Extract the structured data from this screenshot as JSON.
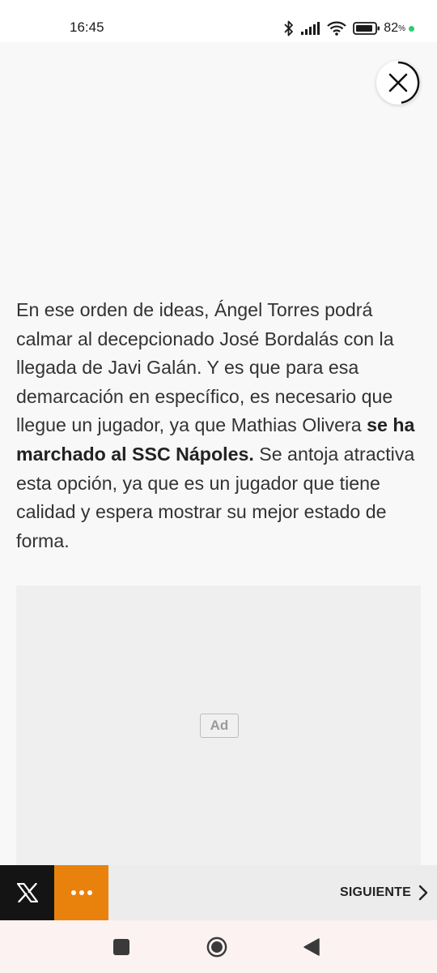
{
  "status_bar": {
    "time": "16:45",
    "battery_percent": "82",
    "battery_unit": "%",
    "icons": [
      "bluetooth-icon",
      "signal-icon",
      "wifi-icon",
      "battery-icon",
      "charging-dot"
    ]
  },
  "ad_overlay": {
    "close_icon": "close-icon",
    "ad_label": "Ad"
  },
  "article": {
    "para_part1": "En ese orden de ideas, Ángel Torres podrá calmar al decepcionado José Bordalás con la llegada de Javi Galán. Y es que para esa demarcación en específico, es necesario que llegue un jugador, ya que Mathias Olivera ",
    "para_bold": "se ha marchado al SSC Nápoles.",
    "para_part2": " Se antoja atractiva esta opción, ya que es un jugador que tiene calidad y espera mostrar su mejor estado de forma."
  },
  "action_bar": {
    "x_icon": "x-logo-icon",
    "more_icon": "more-dots-icon",
    "next_label": "SIGUIENTE",
    "next_icon": "chevron-right-icon"
  },
  "colors": {
    "more_button": "#e8820c",
    "x_button": "#141414",
    "charge_dot": "#2ecc71"
  }
}
